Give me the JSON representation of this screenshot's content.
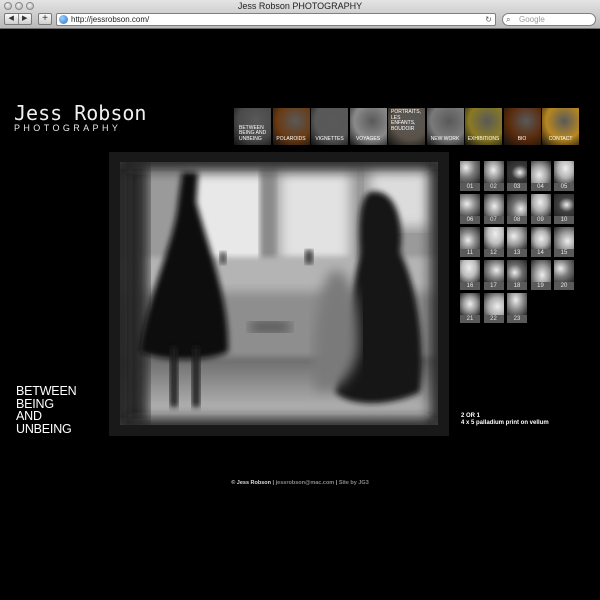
{
  "browser": {
    "title": "Jess Robson PHOTOGRAPHY",
    "back_icon": "◀",
    "forward_icon": "▶",
    "add_icon": "+",
    "url": "http://jessrobson.com/",
    "reload_icon": "↻",
    "search_placeholder": "Google",
    "search_icon": "⌕"
  },
  "site": {
    "name": "Jess Robson",
    "tagline": "PHOTOGRAPHY"
  },
  "nav": [
    {
      "label": "BETWEEN BEING AND UNBEING",
      "color": "#4a4a4a"
    },
    {
      "label": "POLAROIDS",
      "color": "#6a3a12"
    },
    {
      "label": "VIGNETTES",
      "color": "#585858"
    },
    {
      "label": "VOYAGES",
      "color": "#8a8a8a"
    },
    {
      "label": "PORTRAITS, LES ENFANTS, BOUDOIR",
      "color": "#5a5248"
    },
    {
      "label": "NEW WORK",
      "color": "#7a7a7a"
    },
    {
      "label": "EXHIBITIONS",
      "color": "#8a7a22"
    },
    {
      "label": "BIO",
      "color": "#5a2a0a"
    },
    {
      "label": "CONTACT",
      "color": "#b88820"
    }
  ],
  "series": {
    "line1": "BETWEEN",
    "line2": "BEING",
    "line3": "AND",
    "line4": "UNBEING"
  },
  "thumbnails": [
    {
      "num": "01",
      "tone": "#7a7a7a"
    },
    {
      "num": "02",
      "tone": "#9a9a9a"
    },
    {
      "num": "03",
      "tone": "#3a3a3a"
    },
    {
      "num": "04",
      "tone": "#a5a5a5"
    },
    {
      "num": "05",
      "tone": "#b5b5b5"
    },
    {
      "num": "06",
      "tone": "#8a8a8a"
    },
    {
      "num": "07",
      "tone": "#9a9a9a"
    },
    {
      "num": "08",
      "tone": "#707070"
    },
    {
      "num": "09",
      "tone": "#b0b0b0"
    },
    {
      "num": "10",
      "tone": "#404040"
    },
    {
      "num": "11",
      "tone": "#888888"
    },
    {
      "num": "12",
      "tone": "#c0c0c0"
    },
    {
      "num": "13",
      "tone": "#a0a0a0"
    },
    {
      "num": "14",
      "tone": "#b5b5b5"
    },
    {
      "num": "15",
      "tone": "#9a9a9a"
    },
    {
      "num": "16",
      "tone": "#bdbdbd"
    },
    {
      "num": "17",
      "tone": "#8a8a8a"
    },
    {
      "num": "18",
      "tone": "#6a6a6a"
    },
    {
      "num": "19",
      "tone": "#9a9a9a"
    },
    {
      "num": "20",
      "tone": "#7a7a7a"
    },
    {
      "num": "21",
      "tone": "#a0a0a0"
    },
    {
      "num": "22",
      "tone": "#b0b0b0"
    },
    {
      "num": "23",
      "tone": "#909090"
    }
  ],
  "caption": {
    "line1": "2 OR 1",
    "line2": "4 x 5 palladium print on vellum"
  },
  "footer": {
    "copyright": "© Jess Robson",
    "sep1": " | ",
    "email": "jessrobson@mac.com",
    "sep2": " | ",
    "credit": "Site by JG3"
  }
}
